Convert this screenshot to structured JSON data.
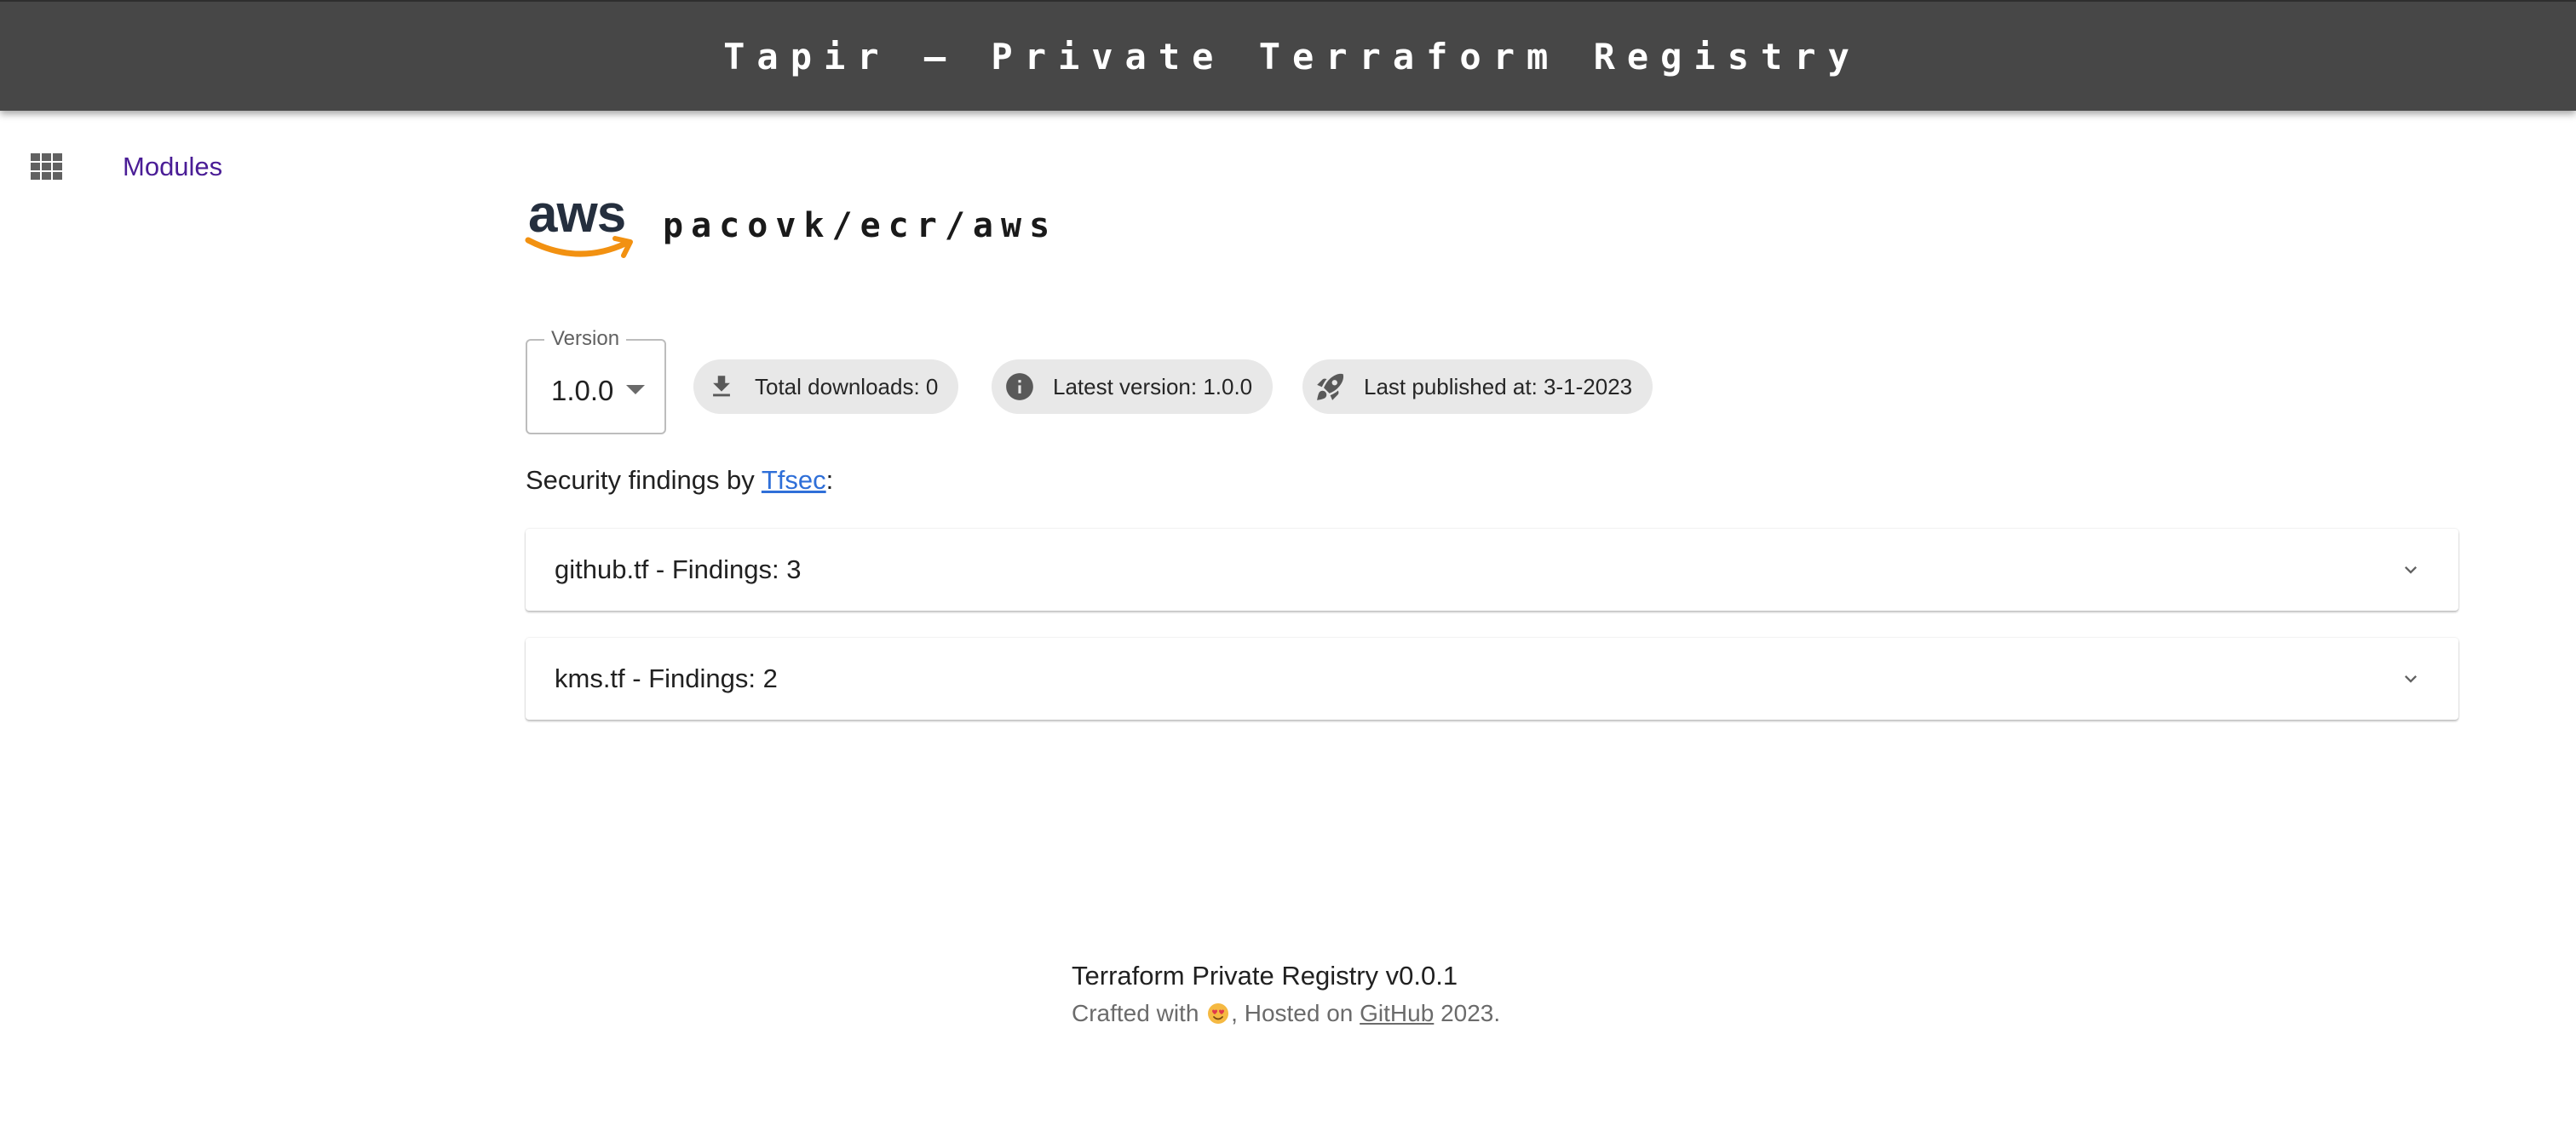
{
  "app_bar": {
    "title": "Tapir – Private Terraform Registry",
    "background": "#474747"
  },
  "nav": {
    "icon": "apps-grid-icon",
    "modules_label": "Modules"
  },
  "module": {
    "logo": "aws-logo",
    "name": "pacovk/ecr/aws"
  },
  "version_select": {
    "legend": "Version",
    "selected": "1.0.0"
  },
  "chips": [
    {
      "icon": "download-icon",
      "label": "Total downloads: 0"
    },
    {
      "icon": "info-icon",
      "label": "Latest version: 1.0.0"
    },
    {
      "icon": "rocket-icon",
      "label": "Last published at: 3-1-2023"
    }
  ],
  "security": {
    "prefix": "Security findings by ",
    "link": "Tfsec",
    "suffix": ":",
    "link_color": "#2f6fd8"
  },
  "findings": [
    {
      "title": "github.tf - Findings: 3",
      "icon": "chevron-down-icon"
    },
    {
      "title": "kms.tf - Findings: 2",
      "icon": "chevron-down-icon"
    }
  ],
  "footer": {
    "title": "Terraform Private Registry v0.0.1",
    "crafted": "Crafted with ",
    "emoji": "heart-eyes-emoji",
    "hosted": ", Hosted on ",
    "github": "GitHub",
    "year": " 2023."
  }
}
